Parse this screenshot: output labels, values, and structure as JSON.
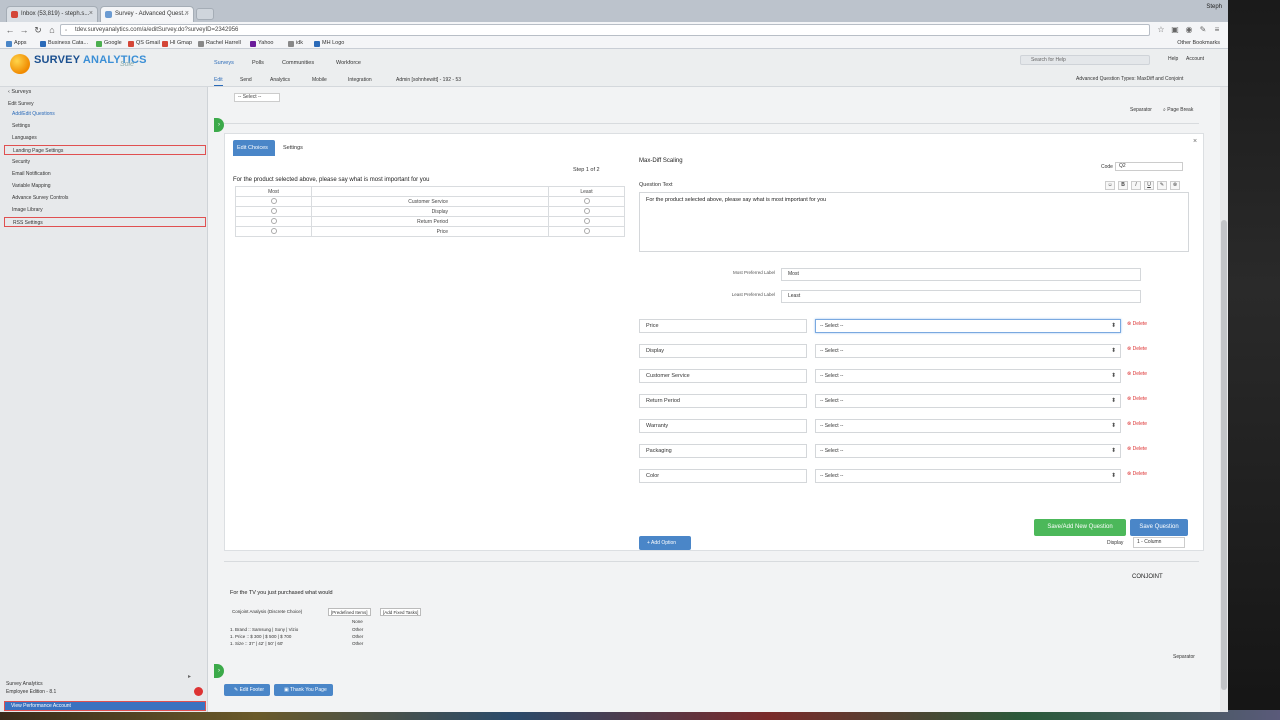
{
  "browser": {
    "tabs": [
      {
        "title": "Inbox (53,819) - steph.s...",
        "favicon_color": "#d44638"
      },
      {
        "title": "Survey - Advanced Quest...",
        "favicon_color": "#6b9bd2"
      }
    ],
    "window_user": "Steph",
    "url": "tdev.surveyanalytics.com/a/editSurvey.do?surveyID=2342956",
    "bookmarks": [
      {
        "label": "Apps",
        "color": "#4a86c8"
      },
      {
        "label": "Business Cata...",
        "color": "#2a6ab8"
      },
      {
        "label": "Google",
        "color": "#4caf50"
      },
      {
        "label": "QS Gmail",
        "color": "#d44638"
      },
      {
        "label": "HI Gmap",
        "color": "#d44638"
      },
      {
        "label": "Rachel Harrell",
        "color": "#888888"
      },
      {
        "label": "Yahoo",
        "color": "#6a1b9a"
      },
      {
        "label": "idk",
        "color": "#888888"
      },
      {
        "label": "MH Logo",
        "color": "#2a6ab8"
      }
    ],
    "other_bookmarks": "Other Bookmarks"
  },
  "app": {
    "logo_word_a": "SURVEY",
    "logo_word_b": "ANALYTICS",
    "logo_sub": "Sole",
    "main_nav": [
      {
        "label": "Surveys",
        "active": true
      },
      {
        "label": "Polls"
      },
      {
        "label": "Communities"
      },
      {
        "label": "Workforce"
      }
    ],
    "sub_nav": [
      {
        "label": "Edit",
        "active": true
      },
      {
        "label": "Send"
      },
      {
        "label": "Analytics"
      },
      {
        "label": "Mobile"
      },
      {
        "label": "Integration"
      },
      {
        "label": "Admin [sohnhewitt] - 192 - 53"
      }
    ],
    "search_placeholder": "Search for Help",
    "help": "Help",
    "account": "Account",
    "advanced_types": "Advanced Question Types: MaxDiff and Conjoint"
  },
  "sidebar": {
    "back": "Surveys",
    "heading": "Edit Survey",
    "items": [
      {
        "label": "Add/Edit Questions",
        "blue": true,
        "hl": false
      },
      {
        "label": "Settings",
        "blue": false,
        "hl": false
      },
      {
        "label": "Languages",
        "blue": false,
        "hl": false
      },
      {
        "label": "Landing Page Settings",
        "blue": false,
        "hl": true
      },
      {
        "label": "Security",
        "blue": false,
        "hl": false
      },
      {
        "label": "Email Notification",
        "blue": false,
        "hl": false
      },
      {
        "label": "Variable Mapping",
        "blue": false,
        "hl": false
      },
      {
        "label": "Advance Survey Controls",
        "blue": false,
        "hl": false
      },
      {
        "label": "Image Library",
        "blue": false,
        "hl": false
      },
      {
        "label": "RSS Settings",
        "blue": false,
        "hl": true
      }
    ],
    "footer_title": "Survey Analytics",
    "footer_edition": "Employee Edition - 8.1",
    "bottom_button": "View Performance Account"
  },
  "main": {
    "top_select": "-- Select --",
    "separator": "Separator",
    "page_break": "Page Break",
    "editor": {
      "tabs": [
        {
          "label": "Edit Choices",
          "active": true
        },
        {
          "label": "Settings"
        }
      ],
      "close": "×",
      "step": "Step 1 of 2",
      "prompt": "For the product selected above, please say what is most important for you",
      "table_headers": [
        "Most",
        "",
        "Least"
      ],
      "table_rows": [
        "Customer Service",
        "Display",
        "Return Period",
        "Price"
      ],
      "question_type": "Max-Diff Scaling",
      "code_label": "Code",
      "code_value": "Q2",
      "question_text_label": "Question Text",
      "format_buttons": [
        "☺",
        "B",
        "I",
        "U",
        "✎",
        "⊗"
      ],
      "question_text": "For the product selected above, please say what is most important for you",
      "most_label": "Most Preferred Label",
      "most_value": "Most",
      "least_label": "Least Preferred Label",
      "least_value": "Least",
      "options": [
        {
          "name": "Price",
          "select": "-- Select --",
          "delete": "Delete",
          "focus": true
        },
        {
          "name": "Display",
          "select": "-- Select --",
          "delete": "Delete"
        },
        {
          "name": "Customer Service",
          "select": "-- Select --",
          "delete": "Delete"
        },
        {
          "name": "Return Period",
          "select": "-- Select --",
          "delete": "Delete"
        },
        {
          "name": "Warranty",
          "select": "-- Select --",
          "delete": "Delete"
        },
        {
          "name": "Packaging",
          "select": "-- Select --",
          "delete": "Delete"
        },
        {
          "name": "Color",
          "select": "-- Select --",
          "delete": "Delete"
        }
      ],
      "add_option": "Add Option",
      "display_label": "Display",
      "columns_value": "1 - Column",
      "save_add": "Save/Add New Question",
      "save": "Save Question"
    },
    "conjoint": "CONJOINT",
    "q2_prompt": "For the TV you just purchased what would",
    "q2_tabs": [
      "Conjoint Analysis (Discrete Choice)",
      "[Predefined Items]",
      "[Add Fixed Tasks]"
    ],
    "q2_none": "None",
    "q2_rows": [
      "1. Brand  :: Samsung  |  Sony  |  Vizio",
      "1. Price  :: $ 300  |  $ 500  |  $ 700",
      "1. Size  ::  37'  |  42'  |  50'  |  60'"
    ],
    "q2_other": "Other",
    "separator_bottom": "Separator",
    "edit_footer": "Edit Footer",
    "thank_you": "Thank You Page"
  }
}
